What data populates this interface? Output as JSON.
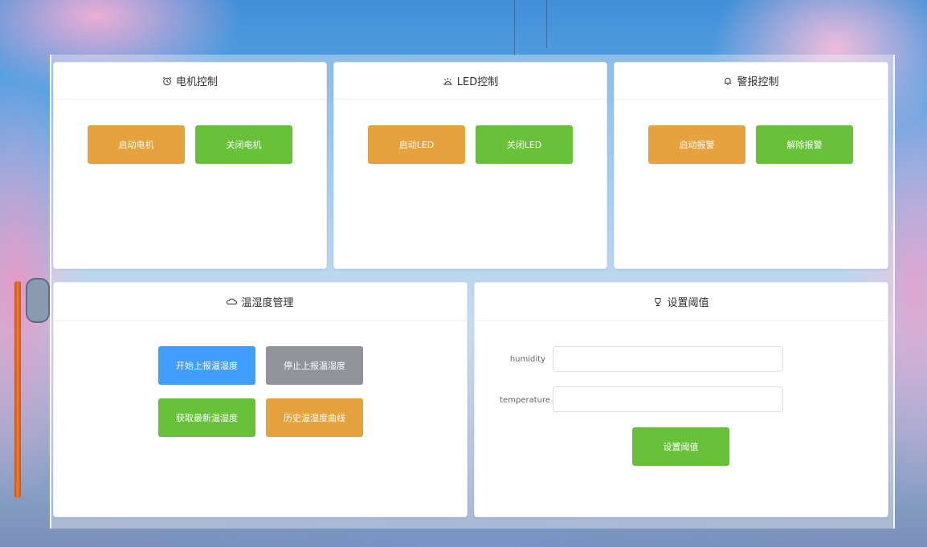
{
  "motor": {
    "title": "电机控制",
    "start_label": "启动电机",
    "stop_label": "关闭电机"
  },
  "led": {
    "title": "LED控制",
    "start_label": "启动LED",
    "stop_label": "关闭LED"
  },
  "alarm": {
    "title": "警报控制",
    "start_label": "启动报警",
    "stop_label": "解除报警"
  },
  "temp_humidity": {
    "title": "温湿度管理",
    "start_report_label": "开始上报温湿度",
    "stop_report_label": "停止上报温湿度",
    "get_latest_label": "获取最新温湿度",
    "history_curve_label": "历史温湿度曲线"
  },
  "threshold": {
    "title": "设置阈值",
    "humidity_label": "humidity",
    "humidity_value": "",
    "temperature_label": "temperature",
    "temperature_value": "",
    "submit_label": "设置阈值"
  },
  "colors": {
    "orange": "#e6a23c",
    "green": "#67c23a",
    "blue": "#409eff",
    "gray": "#909399"
  },
  "icons": {
    "motor": "alarm-clock-icon",
    "led": "lamp-icon",
    "alarm": "bell-icon",
    "temp_humidity": "cloud-icon",
    "threshold": "trophy-icon"
  }
}
